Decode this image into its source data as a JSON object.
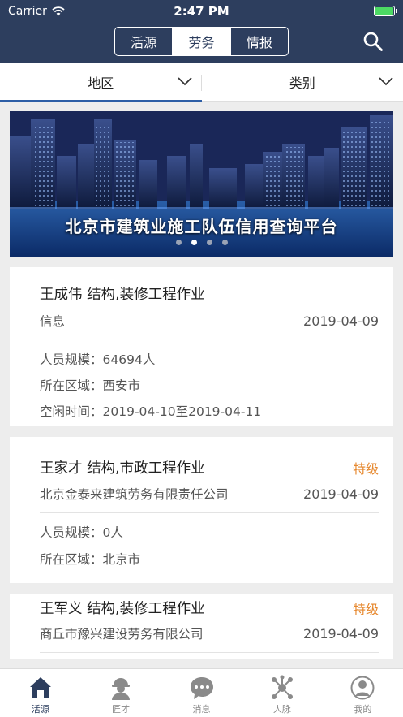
{
  "status_bar": {
    "carrier": "Carrier",
    "time": "2:47 PM"
  },
  "header": {
    "tabs": [
      {
        "label": "活源"
      },
      {
        "label": "劳务",
        "active": true
      },
      {
        "label": "情报"
      }
    ]
  },
  "filters": [
    {
      "label": "地区"
    },
    {
      "label": "类别"
    }
  ],
  "banner": {
    "title": "北京市建筑业施工队伍信用查询平台",
    "slide_count": 4,
    "active_slide": 2
  },
  "listings": [
    {
      "name": "王成伟 结构,装修工程作业",
      "level": "",
      "company": "信息",
      "date": "2019-04-09",
      "scale_label": "人员规模：",
      "scale": "64694人",
      "area_label": "所在区域：",
      "area": "西安市",
      "free_label": "空闲时间：",
      "free": "2019-04-10至2019-04-11"
    },
    {
      "name": "王家才 结构,市政工程作业",
      "level": "特级",
      "company": "北京金泰来建筑劳务有限责任公司",
      "date": "2019-04-09",
      "scale_label": "人员规模：",
      "scale": "0人",
      "area_label": "所在区域：",
      "area": "北京市"
    },
    {
      "name": "王军义 结构,装修工程作业",
      "level": "特级",
      "company": "商丘市豫兴建设劳务有限公司",
      "date": "2019-04-09"
    }
  ],
  "tab_bar": [
    {
      "label": "活源",
      "icon": "home-icon",
      "active": true
    },
    {
      "label": "匠才",
      "icon": "worker-icon"
    },
    {
      "label": "消息",
      "icon": "message-icon"
    },
    {
      "label": "人脉",
      "icon": "network-icon"
    },
    {
      "label": "我的",
      "icon": "profile-icon"
    }
  ],
  "colors": {
    "nav": "#2d3e5e",
    "accent": "#e6872c",
    "active_indicator": "#2d5ea6"
  }
}
